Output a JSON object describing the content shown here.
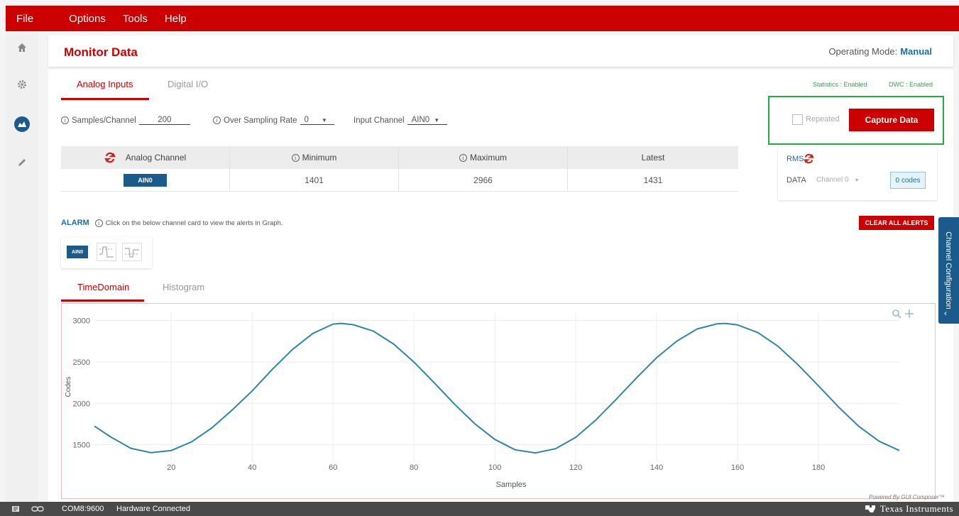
{
  "menu": {
    "items": [
      "File",
      "Options",
      "Tools",
      "Help"
    ]
  },
  "header": {
    "title": "Monitor Data",
    "operating_mode_label": "Operating Mode:",
    "operating_mode_value": "Manual"
  },
  "tabs": {
    "analog": "Analog Inputs",
    "digital": "Digital I/O"
  },
  "status_flags": {
    "statistics": "Statistics : Enabled",
    "dwc": "DWC : Enabled"
  },
  "controls": {
    "samples_label": "Samples/Channel",
    "samples_value": "200",
    "osr_label": "Over Sampling Rate",
    "osr_value": "0",
    "input_channel_label": "Input Channel",
    "input_channel_value": "AIN0"
  },
  "capture": {
    "repeated_label": "Repeated",
    "button": "Capture Data"
  },
  "table": {
    "headers": [
      "Analog Channel",
      "Minimum",
      "Maximum",
      "Latest"
    ],
    "row": {
      "channel": "AIN0",
      "minimum": "1401",
      "maximum": "2966",
      "latest": "1431"
    }
  },
  "rms": {
    "title": "RMS",
    "data_label": "DATA",
    "channel_select": "Channel 0",
    "codes": "0 codes"
  },
  "alarm": {
    "title": "ALARM",
    "hint": "Click on the below channel card to view the alerts in Graph.",
    "clear_button": "CLEAR ALL ALERTS",
    "chip": "AIN0"
  },
  "chart_tabs": {
    "time": "TimeDomain",
    "histogram": "Histogram"
  },
  "chart_data": {
    "type": "line",
    "xlabel": "Samples",
    "ylabel": "Codes",
    "xlim": [
      1,
      200
    ],
    "ylim": [
      1300,
      3100
    ],
    "xticks": [
      20,
      40,
      60,
      80,
      100,
      120,
      140,
      160,
      180
    ],
    "yticks": [
      1500,
      2000,
      2500,
      3000
    ],
    "grid": true,
    "series": [
      {
        "color": "#2e86a8",
        "x": [
          1,
          5,
          10,
          15,
          20,
          25,
          30,
          35,
          40,
          45,
          50,
          55,
          60,
          62,
          65,
          70,
          75,
          80,
          85,
          90,
          95,
          100,
          105,
          110,
          115,
          120,
          125,
          130,
          135,
          140,
          145,
          150,
          155,
          157,
          160,
          165,
          170,
          175,
          180,
          185,
          190,
          195,
          200
        ],
        "y": [
          1725,
          1596,
          1458,
          1405,
          1431,
          1535,
          1703,
          1917,
          2150,
          2412,
          2653,
          2845,
          2958,
          2966,
          2950,
          2872,
          2715,
          2498,
          2249,
          1992,
          1755,
          1564,
          1440,
          1402,
          1453,
          1591,
          1801,
          2049,
          2307,
          2552,
          2753,
          2899,
          2962,
          2966,
          2947,
          2855,
          2690,
          2464,
          2212,
          1955,
          1722,
          1543,
          1431
        ]
      }
    ]
  },
  "chart_icons": {
    "zoom": "zoom-icon",
    "pan": "pan-icon"
  },
  "powered_by": "Powered By GUI Composer™",
  "side_panel": {
    "label": "Channel Configuration"
  },
  "statusbar": {
    "port": "COM8:9600",
    "connection": "Hardware Connected",
    "brand": "Texas Instruments"
  }
}
